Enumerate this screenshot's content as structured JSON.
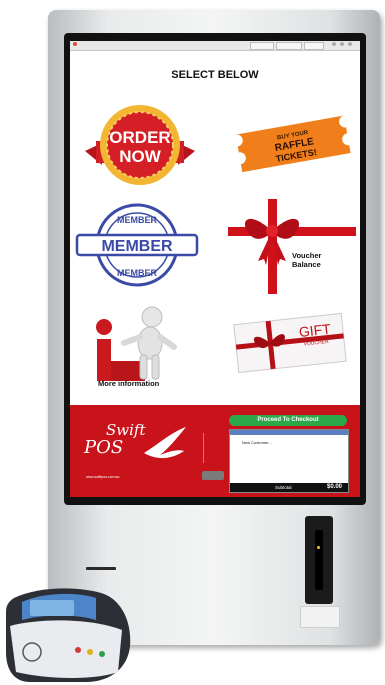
{
  "screen": {
    "title": "SELECT BELOW",
    "tiles": {
      "order_now": {
        "line1": "ORDER",
        "line2": "NOW"
      },
      "raffle": {
        "line1": "BUY YOUR",
        "line2": "RAFFLE",
        "line3": "TICKETS!"
      },
      "member": {
        "top": "MEMBER",
        "main": "MEMBER",
        "bottom": "MEMBER"
      },
      "voucher": {
        "label_line1": "Voucher",
        "label_line2": "Balance"
      },
      "more_info": {
        "label": "More information"
      },
      "gift": {
        "main": "GIFT",
        "sub": "VOUCHER"
      }
    },
    "checkout": {
      "button_label": "Proceed To Checkout",
      "customer": "New Customer...",
      "footer_label": "Subtotal",
      "total": "$0.00"
    },
    "brand": {
      "name_top": "Swift",
      "name_bottom": "POS",
      "url": "www.swiftpos.com.au"
    }
  },
  "colors": {
    "accent_red": "#c9131b",
    "checkout_green": "#2aa84a",
    "header_blue": "#5b7fc0"
  },
  "icons": [
    "pizza-order-badge-icon",
    "raffle-ticket-icon",
    "member-stamp-icon",
    "ribbon-bow-icon",
    "info-figure-icon",
    "gift-voucher-icon",
    "card-reader-icon",
    "eftpos-terminal-icon"
  ]
}
